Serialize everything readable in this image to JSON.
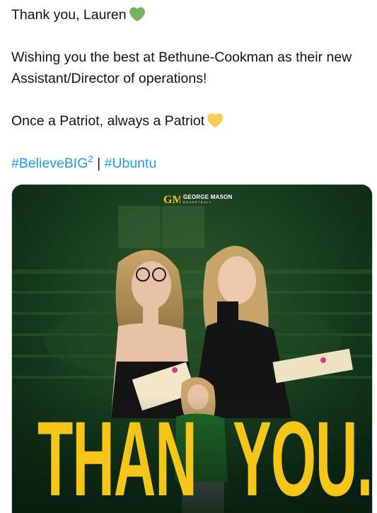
{
  "tweet": {
    "line1": "Thank you, Lauren",
    "line2": "Wishing you the best at Bethune-Cookman as their new",
    "line3": "Assistant/Director of operations!",
    "line4": "Once a Patriot, always a Patriot",
    "hashtag1": "#BelieveBIG",
    "hashtag1_sup": "2",
    "separator": "|",
    "hashtag2": "#Ubuntu",
    "emoji1": "green-heart",
    "emoji2": "yellow-heart"
  },
  "media": {
    "logo_monogram": "GM",
    "logo_title": "GEORGE MASON",
    "logo_subtitle": "BASKETBALL",
    "headline_left": "THAN",
    "headline_right": "YOU."
  },
  "colors": {
    "text": "#0f1419",
    "hashtag": "#1d9bf0",
    "green_heart": "#78b159",
    "yellow_heart": "#fdcb58",
    "media_green": "#0c2a16",
    "headline_yellow": "#f5c518"
  }
}
